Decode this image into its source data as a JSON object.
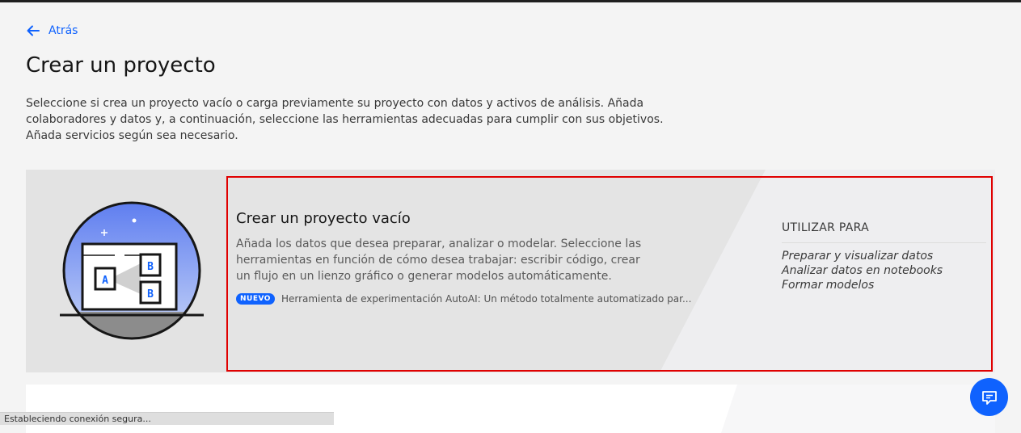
{
  "nav": {
    "back_label": "Atrás"
  },
  "page": {
    "title": "Crear un proyecto",
    "description": "Seleccione si crea un proyecto vacío o carga previamente su proyecto con datos y activos de análisis. Añada colaboradores y datos y, a continuación, seleccione las herramientas adecuadas para cumplir con sus objetivos. Añada servicios según sea necesario."
  },
  "empty_project_tile": {
    "title": "Crear un proyecto vacío",
    "description": "Añada los datos que desea preparar, analizar o modelar. Seleccione las herramientas en función de cómo desea trabajar: escribir código, crear un flujo en un lienzo gráfico o generar modelos automáticamente.",
    "badge": "NUEVO",
    "new_feature_text": "Herramienta de experimentación AutoAI: Un método totalmente automatizado par...",
    "use_for_title": "UTILIZAR PARA",
    "use_for_items": [
      "Preparar y visualizar datos",
      "Analizar datos en notebooks",
      "Formar modelos"
    ],
    "illustration_labels": {
      "a": "A",
      "b1": "B",
      "b2": "B"
    }
  },
  "status_bar": {
    "text": "Estableciendo conexión segura..."
  },
  "icons": {
    "back": "arrow-left-icon",
    "chat": "chat-icon"
  },
  "colors": {
    "accent": "#0f62fe",
    "highlight": "#e00000"
  }
}
